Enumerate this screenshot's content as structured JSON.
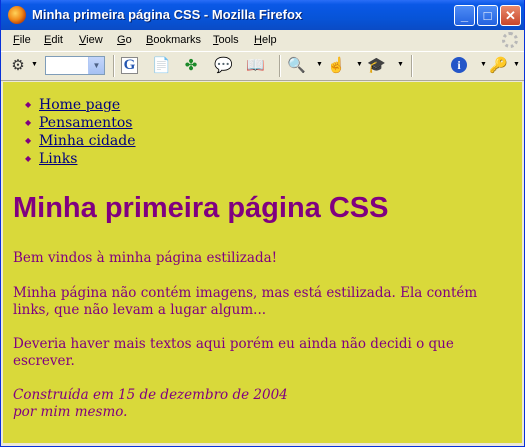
{
  "window": {
    "title": "Minha primeira página CSS - Mozilla Firefox"
  },
  "menubar": {
    "items": [
      {
        "pre": "",
        "key": "F",
        "post": "ile"
      },
      {
        "pre": "",
        "key": "E",
        "post": "dit"
      },
      {
        "pre": "",
        "key": "V",
        "post": "iew"
      },
      {
        "pre": "",
        "key": "G",
        "post": "o"
      },
      {
        "pre": "",
        "key": "B",
        "post": "ookmarks"
      },
      {
        "pre": "",
        "key": "T",
        "post": "ools"
      },
      {
        "pre": "",
        "key": "H",
        "post": "elp"
      }
    ]
  },
  "toolbar": {
    "icons": [
      "back-icon",
      "font-size-select",
      "google-icon",
      "translate-icon",
      "clover-icon",
      "comment-icon",
      "book-icon",
      "zoom-icon",
      "pointer-icon",
      "graduation-cap-icon",
      "info-icon",
      "user-edit-icon"
    ]
  },
  "page": {
    "nav": [
      "Home page",
      "Pensamentos",
      "Minha cidade",
      "Links"
    ],
    "heading": "Minha primeira página CSS",
    "paragraphs": [
      "Bem vindos à minha página estilizada!",
      "Minha página não contém imagens, mas está estilizada. Ela contém links, que não levam a lugar algum...",
      "Deveria haver mais textos aqui porém eu ainda não decidi o que escrever."
    ],
    "footer_line1": "Construída em 15 de dezembro de 2004",
    "footer_line2": "por mim mesmo."
  },
  "colors": {
    "background": "#d9d93a",
    "text": "#800080",
    "link": "#000080"
  }
}
